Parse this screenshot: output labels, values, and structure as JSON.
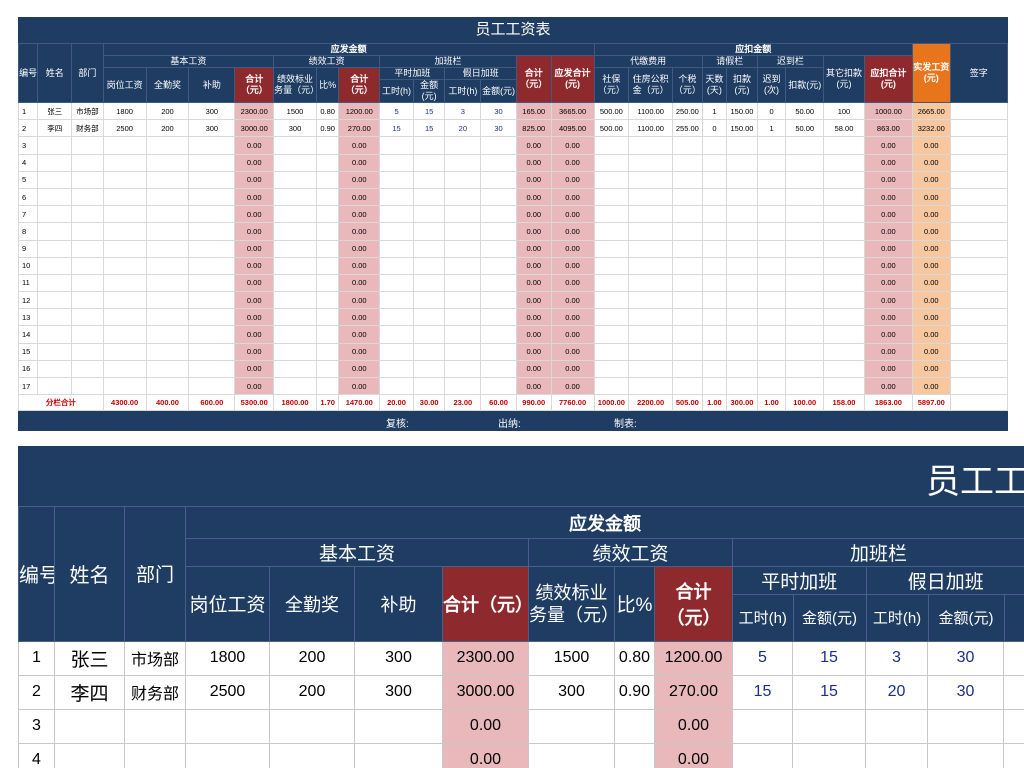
{
  "sheet": {
    "title": "员工工资表",
    "headers": {
      "no": "编号",
      "name": "姓名",
      "dept": "部门",
      "yingfa": "应发金额",
      "jiben": "基本工资",
      "gangwei": "岗位工资",
      "quanqin": "全勤奖",
      "buzhu": "补助",
      "heji": "合计（元）",
      "jixiao": "绩效工资",
      "jixiaobiao": "绩效标业务量（元）",
      "bi": "比%",
      "jiaban": "加班栏",
      "pingshi": "平时加班",
      "jiari": "假日加班",
      "gongshi": "工时(h)",
      "jine": "金额(元)",
      "yingfaheji": "应发合计(元)",
      "yingkou": "应扣金额",
      "daijiao": "代缴费用",
      "shebao": "社保（元）",
      "zhufang": "住房公积金（元）",
      "geshui": "个税（元）",
      "qingjia": "请假栏",
      "tianshu": "天数(天)",
      "koukuan": "扣款(元)",
      "chidao": "迟到栏",
      "chidaoci": "迟到(次)",
      "qita": "其它扣款(元)",
      "yingkouheji": "应扣合计(元)",
      "shifa": "实发工资(元)",
      "qianzi": "签字"
    },
    "rows": [
      {
        "no": "1",
        "name": "张三",
        "dept": "市场部",
        "gangwei": "1800",
        "quanqin": "200",
        "buzhu": "300",
        "heji": "2300.00",
        "jxb": "1500",
        "bi": "0.80",
        "jxheji": "1200.00",
        "psgs": "5",
        "psje": "15",
        "jrgs": "3",
        "jrje": "30",
        "jbheji": "165.00",
        "yfheji": "3665.00",
        "shebao": "500.00",
        "zhufang": "1100.00",
        "geshui": "250.00",
        "tianshu": "1",
        "qjkk": "150.00",
        "chidao": "0",
        "cdkk": "50.00",
        "qita": "100",
        "ykheji": "1000.00",
        "shifa": "2665.00"
      },
      {
        "no": "2",
        "name": "李四",
        "dept": "财务部",
        "gangwei": "2500",
        "quanqin": "200",
        "buzhu": "300",
        "heji": "3000.00",
        "jxb": "300",
        "bi": "0.90",
        "jxheji": "270.00",
        "psgs": "15",
        "psje": "15",
        "jrgs": "20",
        "jrje": "30",
        "jbheji": "825.00",
        "yfheji": "4095.00",
        "shebao": "500.00",
        "zhufang": "1100.00",
        "geshui": "255.00",
        "tianshu": "0",
        "qjkk": "150.00",
        "chidao": "1",
        "cdkk": "50.00",
        "qita": "58.00",
        "ykheji": "863.00",
        "shifa": "3232.00"
      }
    ],
    "empty_row_numbers": [
      "3",
      "4",
      "5",
      "6",
      "7",
      "8",
      "9",
      "10",
      "11",
      "12",
      "13",
      "14",
      "15",
      "16",
      "17"
    ],
    "zero_value": "0.00",
    "totals": {
      "label": "分栏合计",
      "values": [
        "4300.00",
        "400.00",
        "600.00",
        "5300.00",
        "1800.00",
        "1.70",
        "1470.00",
        "20.00",
        "30.00",
        "23.00",
        "60.00",
        "990.00",
        "7760.00",
        "1000.00",
        "2200.00",
        "505.00",
        "1.00",
        "300.00",
        "1.00",
        "100.00",
        "158.00",
        "1863.00",
        "5897.00"
      ]
    },
    "footer": {
      "review": "复核:",
      "cashier": "出纳:",
      "maker": "制表:"
    },
    "zoom_title": "员工工",
    "zoom_empty_rows": [
      "3",
      "4"
    ]
  },
  "colors": {
    "header_navy": "#1f3d63",
    "sum_red_header": "#8e2a2e",
    "sum_pink_cell": "#e8b8bb",
    "net_orange_header": "#e8741c",
    "net_orange_cell": "#f7c8a0",
    "totals_text": "#c00000",
    "hours_blue": "#1a2f8a"
  }
}
